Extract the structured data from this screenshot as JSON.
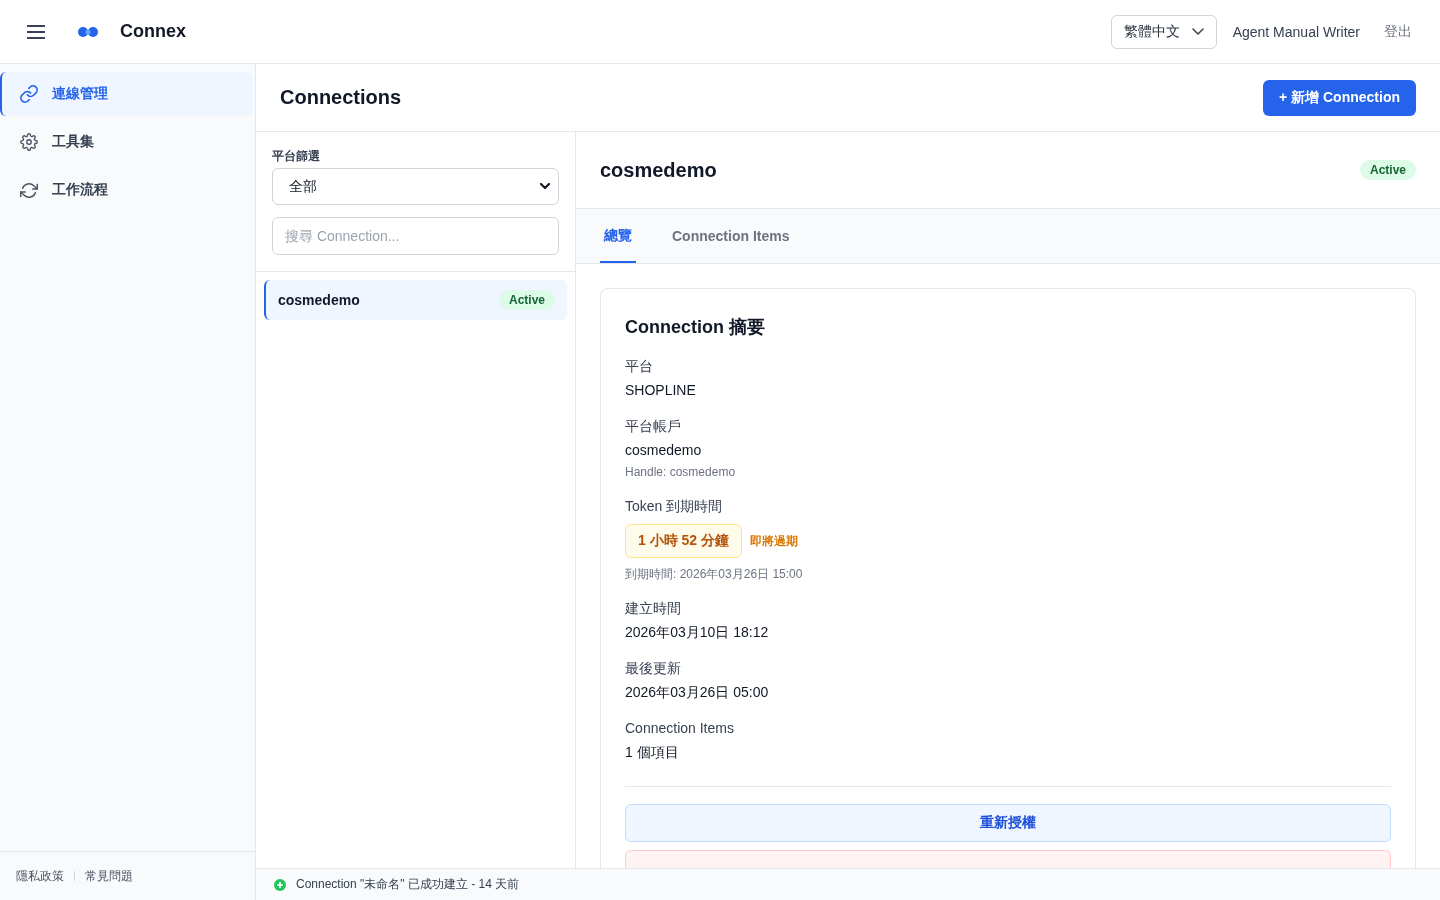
{
  "header": {
    "app_name": "Connex",
    "language": "繁體中文",
    "user": "Agent Manual Writer",
    "logout": "登出"
  },
  "sidebar": {
    "items": [
      {
        "label": "連線管理",
        "selected": true
      },
      {
        "label": "工具集",
        "selected": false
      },
      {
        "label": "工作流程",
        "selected": false
      }
    ],
    "footer_links": [
      "隱私政策",
      "常見問題"
    ]
  },
  "page": {
    "title": "Connections",
    "new_button": "+ 新增 Connection"
  },
  "filter": {
    "label": "平台篩選",
    "value": "全部"
  },
  "search": {
    "placeholder": "搜尋 Connection..."
  },
  "connections": [
    {
      "name": "cosmedemo",
      "status": "Active",
      "selected": true
    }
  ],
  "detail": {
    "name": "cosmedemo",
    "status": "Active",
    "tabs": [
      {
        "label": "總覽",
        "selected": true
      },
      {
        "label": "Connection Items",
        "selected": false
      }
    ],
    "summary": {
      "title": "Connection 摘要",
      "fields": [
        {
          "kind": "text",
          "label": "平台",
          "value": "SHOPLINE"
        },
        {
          "kind": "text",
          "label": "平台帳戶",
          "value": "cosmedemo",
          "note": "Handle: cosmedemo"
        },
        {
          "kind": "countdown",
          "label": "Token 到期時間",
          "value": "1 小時 52 分鐘",
          "warning": "即將過期",
          "note": "到期時間: 2026年03月26日 15:00"
        },
        {
          "kind": "text",
          "label": "建立時間",
          "value": "2026年03月10日 18:12"
        },
        {
          "kind": "text",
          "label": "最後更新",
          "value": "2026年03月26日 05:00"
        },
        {
          "kind": "text",
          "label": "Connection Items",
          "value": "1 個項目"
        }
      ]
    },
    "actions": [
      {
        "kind": "primary",
        "label": "重新授權"
      },
      {
        "kind": "danger"
      }
    ]
  },
  "status_bar": {
    "message": "Connection \"未命名\" 已成功建立 - 14 天前"
  }
}
